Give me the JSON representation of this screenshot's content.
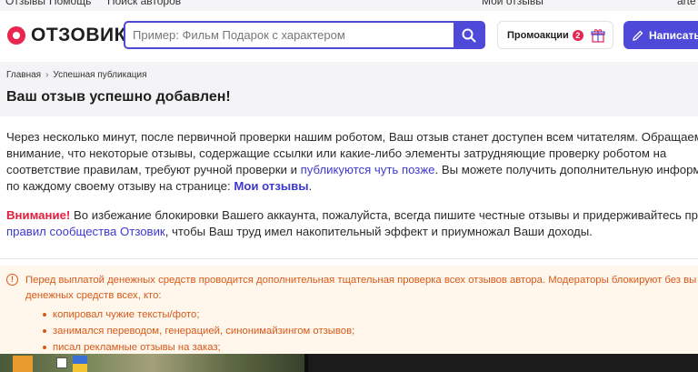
{
  "topbar": {
    "links": [
      "Отзывы",
      "Помощь",
      "Поиск авторов"
    ],
    "my_reviews": "Мои отзывы",
    "username": "arte"
  },
  "header": {
    "logo_text": "ОТЗОВИК",
    "search_placeholder": "Пример: Фильм Подарок с характером",
    "search_icon": "search-icon",
    "promo_label": "Промоакции",
    "promo_count": "2",
    "gift_icon": "gift-icon",
    "write_label": "Написать",
    "write_icon": "pencil-icon"
  },
  "breadcrumb": {
    "home": "Главная",
    "separator": "›",
    "current": "Успешная публикация"
  },
  "page_title": "Ваш отзыв успешно добавлен!",
  "content": {
    "p1_line1": "Через несколько минут, после первичной проверки нашим роботом, Ваш отзыв станет доступен всем читателям. Обращаем",
    "p1_line2": "внимание, что некоторые отзывы, содержащие ссылки или какие-либо элементы затрудняющие проверку роботом на",
    "p1_line3_start": "соответствие правилам, требуют ручной проверки и ",
    "p1_line3_link": "публикуются чуть позже",
    "p1_line3_end": ". Вы можете получить дополнительную информа",
    "p1_line4_start": "по каждому своему отзыву на странице: ",
    "p1_line4_link": "Мои отзывы",
    "p1_line4_end": ".",
    "attention_label": "Внимание!",
    "p2_line1": " Во избежание блокировки Вашего аккаунта, пожалуйста, всегда пишите честные отзывы и придерживайтесь прав",
    "p2_line2_link": "правил сообщества Отзовик",
    "p2_line2_end": ", чтобы Ваш труд имел накопительный эффект и приумножал Ваши доходы."
  },
  "warning": {
    "icon": "exclamation-circle-icon",
    "line1": "Перед выплатой денежных средств проводится дополнительная тщательная проверка всех отзывов автора. Модераторы блокируют без вы",
    "line2": "денежных средств всех, кто:",
    "items": [
      "копировал чужие тексты/фото;",
      "занимался переводом, генерацией, синонимайзингом отзывов;",
      "писал рекламные отзывы на заказ;"
    ]
  },
  "colors": {
    "accent": "#4f49d9",
    "brand": "#e8264f",
    "warning_text": "#d65a18",
    "warning_bg": "#fff6ec"
  }
}
